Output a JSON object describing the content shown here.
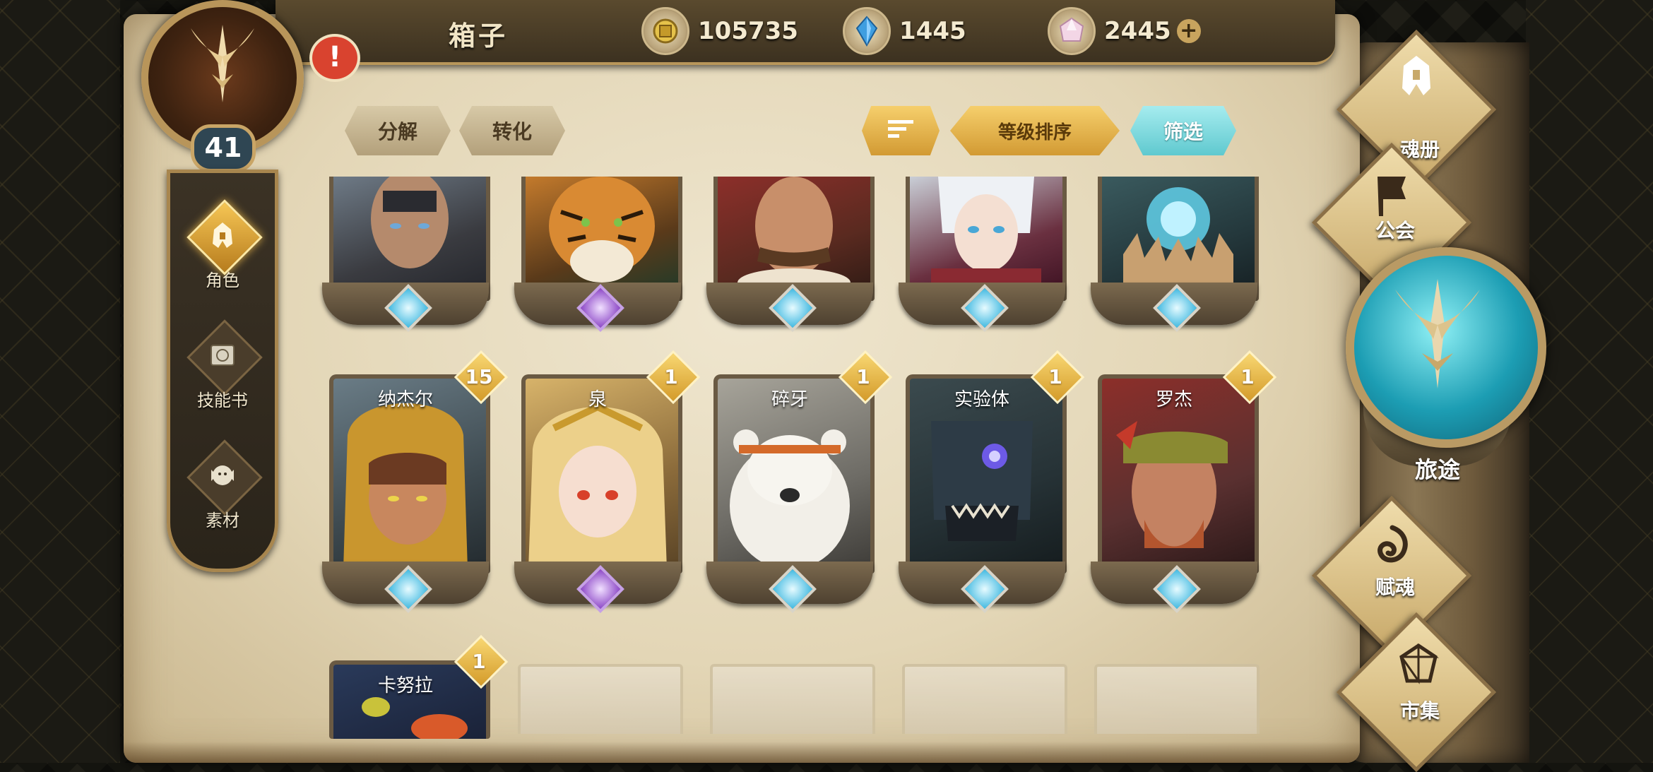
{
  "header": {
    "title": "箱子",
    "resources": [
      {
        "name": "gold-coin",
        "value": "105735"
      },
      {
        "name": "blue-crystal",
        "value": "1445"
      },
      {
        "name": "soul-gem",
        "value": "2445"
      }
    ],
    "plus_label": "+"
  },
  "player": {
    "level": "41",
    "alert": "!"
  },
  "left_menu": [
    {
      "label": "角色",
      "icon": "helmet-icon",
      "active": true
    },
    {
      "label": "技能书",
      "icon": "skill-book-icon",
      "active": false
    },
    {
      "label": "素材",
      "icon": "material-icon",
      "active": false
    }
  ],
  "actions": {
    "decompose": "分解",
    "convert": "转化",
    "sort_icon": "sort-icon",
    "level_sort": "等级排序",
    "filter": "筛选"
  },
  "cards_row1": [
    {
      "name": "",
      "gem": "blue"
    },
    {
      "name": "",
      "gem": "purple"
    },
    {
      "name": "",
      "gem": "blue"
    },
    {
      "name": "",
      "gem": "blue"
    },
    {
      "name": "",
      "gem": "blue"
    }
  ],
  "cards_row2": [
    {
      "name": "纳杰尔",
      "count": "15",
      "gem": "blue"
    },
    {
      "name": "泉",
      "count": "1",
      "gem": "purple"
    },
    {
      "name": "碎牙",
      "count": "1",
      "gem": "blue"
    },
    {
      "name": "实验体",
      "count": "1",
      "gem": "blue"
    },
    {
      "name": "罗杰",
      "count": "1",
      "gem": "blue"
    }
  ],
  "cards_row3": [
    {
      "name": "卡努拉",
      "count": "1"
    }
  ],
  "right_menu": {
    "soul_book": "魂册",
    "guild": "公会",
    "journey": "旅途",
    "endow_soul": "赋魂",
    "market": "市集"
  }
}
